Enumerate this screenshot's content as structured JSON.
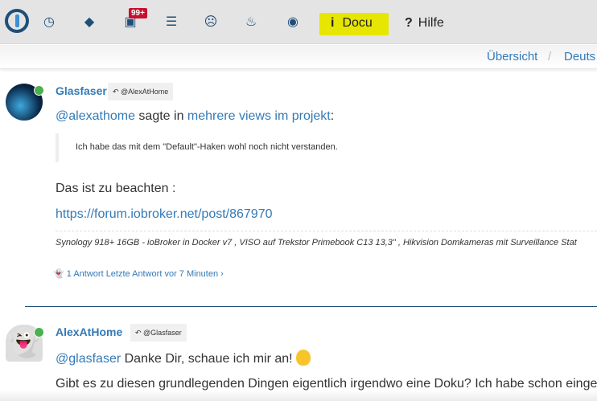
{
  "nav": {
    "badge": "99+",
    "docu_label": "Docu",
    "hilfe_label": "Hilfe",
    "icons": [
      "iobroker-logo",
      "clock-icon",
      "tags-icon",
      "inbox-icon",
      "list-icon",
      "frown-icon",
      "fire-icon",
      "github-icon",
      "info-icon",
      "question-icon"
    ],
    "docu_highlight": "#e6e600"
  },
  "breadcrumb": {
    "items": [
      "Übersicht",
      "Deuts"
    ],
    "separator": "/"
  },
  "posts": [
    {
      "author": "Glasfaser",
      "reply_to": "@AlexAtHome",
      "mention": "@alexathome",
      "said_in": "sagte in",
      "topic": "mehrere views im projekt",
      "colon": ":",
      "quote": "Ich habe das mit dem \"Default\"-Haken wohl noch nicht verstanden.",
      "body1": "Das ist zu beachten :",
      "link": "https://forum.iobroker.net/post/867970",
      "signature": "Synology 918+ 16GB - ioBroker in Docker v7 , VISO auf Trekstor Primebook C13 13,3\" , Hikvision Domkameras mit Surveillance Stat",
      "replies": "1 Antwort",
      "last_reply": "Letzte Antwort vor 7 Minuten"
    },
    {
      "author": "AlexAtHome",
      "reply_to": "@Glasfaser",
      "mention": "@glasfaser",
      "body1": "Danke Dir, schaue ich mir an!",
      "body2": "Gibt es zu diesen grundlegenden Dingen eigentlich irgendwo eine Doku? Ich habe schon einges"
    }
  ],
  "colors": {
    "link": "#337ab7",
    "brand": "#1f4e79",
    "online": "#4caf50",
    "badge": "#c8102e"
  }
}
